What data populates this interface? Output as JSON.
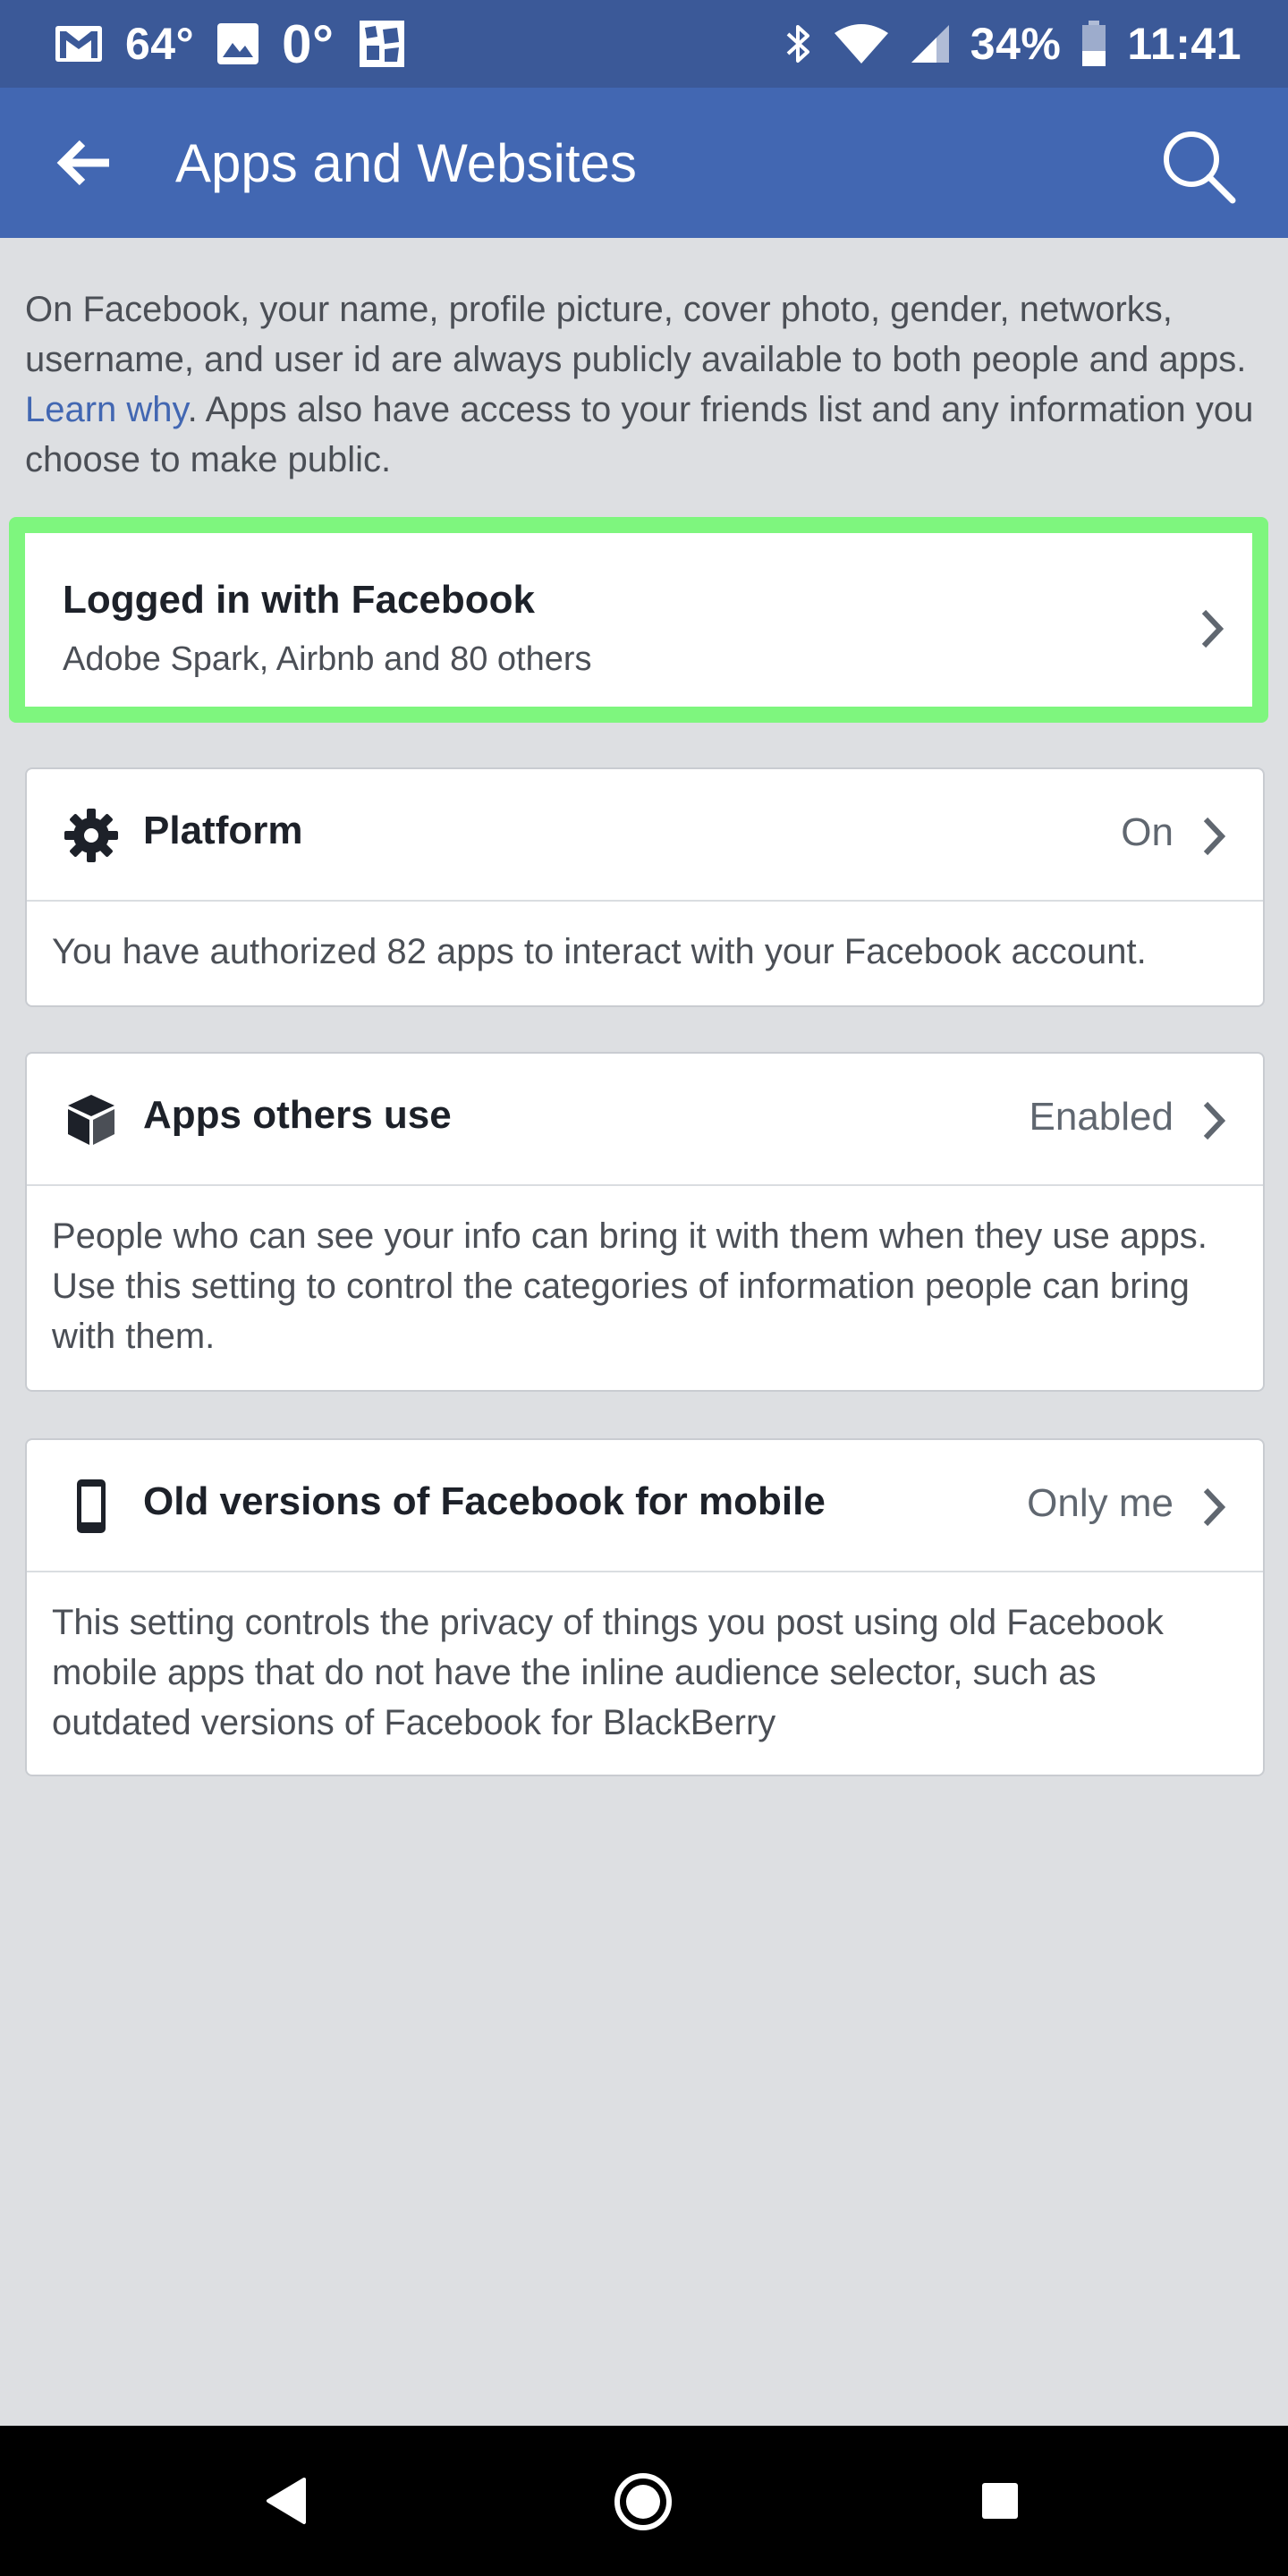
{
  "status_bar": {
    "temp": "64°",
    "temp2": "0°",
    "battery": "34%",
    "time": "11:41",
    "icons": [
      "gmail-icon",
      "image-icon",
      "app-icon",
      "bluetooth-icon",
      "wifi-icon",
      "signal-icon",
      "battery-icon"
    ]
  },
  "app_bar": {
    "title": "Apps and Websites",
    "back_icon": "arrow-left-icon",
    "search_icon": "search-icon"
  },
  "intro": {
    "text_before": "On Facebook, your name, profile picture, cover photo, gender, networks, username, and user id are always publicly available to both people and apps. ",
    "link": "Learn why",
    "text_after": ". Apps also have access to your friends list and any information you choose to make public."
  },
  "login_card": {
    "title": "Logged in with Facebook",
    "subtitle": "Adobe Spark, Airbnb and 80 others",
    "highlight_color": "#7ef67e"
  },
  "settings": [
    {
      "title": "Platform",
      "value": "On",
      "icon": "gear-icon",
      "description": "You have authorized 82 apps to interact with your Facebook account."
    },
    {
      "title": "Apps others use",
      "value": "Enabled",
      "icon": "cube-icon",
      "description": "People who can see your info can bring it with them when they use apps. Use this setting to control the categories of information people can bring with them."
    },
    {
      "title": "Old versions of Facebook for mobile",
      "value": "Only me",
      "icon": "mobile-phone-icon",
      "description": "This setting controls the privacy of things you post using old Facebook mobile apps that do not have the inline audience selector, such as outdated versions of Facebook for BlackBerry"
    }
  ],
  "nav_bar": {
    "icons": [
      "back-triangle-icon",
      "home-circle-icon",
      "recents-square-icon"
    ]
  },
  "colors": {
    "brand_blue": "#4267b2",
    "status_blue": "#3b5998",
    "background": "#dddfe2",
    "highlight": "#7ef67e"
  }
}
